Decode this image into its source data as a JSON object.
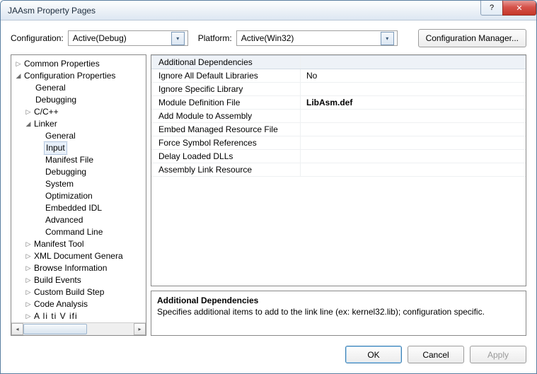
{
  "window": {
    "title": "JAAsm Property Pages"
  },
  "topbar": {
    "configLabel": "Configuration:",
    "configValue": "Active(Debug)",
    "platformLabel": "Platform:",
    "platformValue": "Active(Win32)",
    "cfgMgr": "Configuration Manager..."
  },
  "tree": {
    "common": "Common Properties",
    "configProps": "Configuration Properties",
    "general": "General",
    "debugging": "Debugging",
    "cpp": "C/C++",
    "linker": "Linker",
    "linker_general": "General",
    "linker_input": "Input",
    "linker_manifest": "Manifest File",
    "linker_debugging": "Debugging",
    "linker_system": "System",
    "linker_optimization": "Optimization",
    "linker_embeddedidl": "Embedded IDL",
    "linker_advanced": "Advanced",
    "linker_cmdline": "Command Line",
    "manifestTool": "Manifest Tool",
    "xmldoc": "XML Document Genera",
    "browseInfo": "Browse Information",
    "buildEvents": "Build Events",
    "customBuild": "Custom Build Step",
    "codeAnalysis": "Code Analysis",
    "appverif": "A    li   ti    V   ifi"
  },
  "grid": {
    "rows": [
      {
        "k": "Additional Dependencies",
        "v": ""
      },
      {
        "k": "Ignore All Default Libraries",
        "v": "No"
      },
      {
        "k": "Ignore Specific Library",
        "v": ""
      },
      {
        "k": "Module Definition File",
        "v": "LibAsm.def"
      },
      {
        "k": "Add Module to Assembly",
        "v": ""
      },
      {
        "k": "Embed Managed Resource File",
        "v": ""
      },
      {
        "k": "Force Symbol References",
        "v": ""
      },
      {
        "k": "Delay Loaded DLLs",
        "v": ""
      },
      {
        "k": "Assembly Link Resource",
        "v": ""
      }
    ]
  },
  "desc": {
    "title": "Additional Dependencies",
    "text": "Specifies additional items to add to the link line (ex: kernel32.lib); configuration specific."
  },
  "footer": {
    "ok": "OK",
    "cancel": "Cancel",
    "apply": "Apply"
  },
  "glyph": {
    "tri_right": "▷",
    "tri_down": "◢",
    "tri_dn_small": "▾",
    "arrow_l": "◂",
    "arrow_r": "▸",
    "help": "?",
    "close": "✕"
  }
}
